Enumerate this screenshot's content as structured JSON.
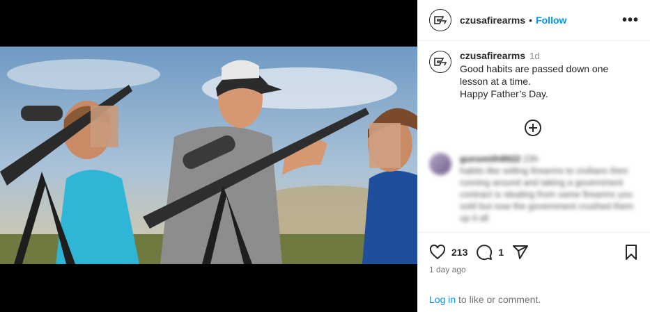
{
  "post": {
    "username": "czusafirearms",
    "follow_label": "Follow",
    "separator": "•",
    "more_label": "•••",
    "time_short": "1d",
    "caption": "Good habits are passed down one\nlesson at a time.\nHappy Father’s Day.",
    "likes": "213",
    "comments_count": "1",
    "time_ago": "1 day ago"
  },
  "comment": {
    "username": "gunsmith8922",
    "time": "23h",
    "text": "habits like selling firearms to civilians then running around and taking a government contract is stealing from same firearms you sold but now the government crushed them up it all"
  },
  "footer": {
    "login_label": "Log in",
    "login_suffix": " to like or comment."
  },
  "icons": {
    "like": "heart-icon",
    "comment": "comment-icon",
    "share": "share-icon",
    "save": "bookmark-icon",
    "load_more": "plus-circle-icon"
  },
  "colors": {
    "link": "#0095f6",
    "text": "#262626",
    "muted": "#737373"
  }
}
